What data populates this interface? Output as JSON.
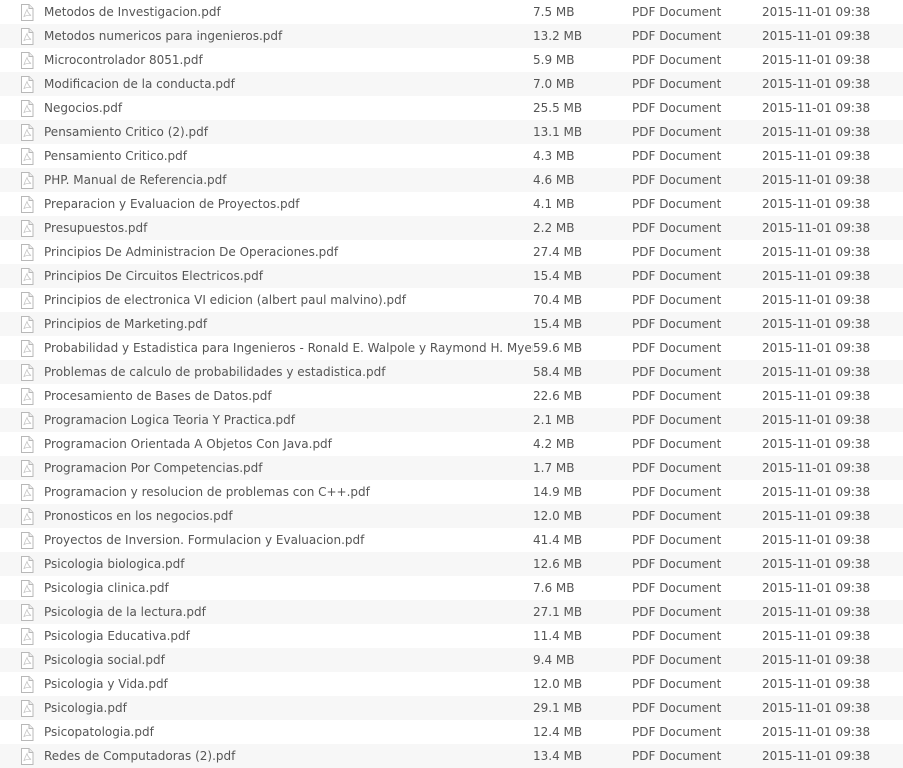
{
  "files": [
    {
      "name": "Metodos de Investigacion.pdf",
      "size": "7.5 MB",
      "type": "PDF Document",
      "date": "2015-11-01 09:38"
    },
    {
      "name": "Metodos numericos para ingenieros.pdf",
      "size": "13.2 MB",
      "type": "PDF Document",
      "date": "2015-11-01 09:38"
    },
    {
      "name": "Microcontrolador 8051.pdf",
      "size": "5.9 MB",
      "type": "PDF Document",
      "date": "2015-11-01 09:38"
    },
    {
      "name": "Modificacion de la conducta.pdf",
      "size": "7.0 MB",
      "type": "PDF Document",
      "date": "2015-11-01 09:38"
    },
    {
      "name": "Negocios.pdf",
      "size": "25.5 MB",
      "type": "PDF Document",
      "date": "2015-11-01 09:38"
    },
    {
      "name": "Pensamiento Critico (2).pdf",
      "size": "13.1 MB",
      "type": "PDF Document",
      "date": "2015-11-01 09:38"
    },
    {
      "name": "Pensamiento Critico.pdf",
      "size": "4.3 MB",
      "type": "PDF Document",
      "date": "2015-11-01 09:38"
    },
    {
      "name": "PHP. Manual de Referencia.pdf",
      "size": "4.6 MB",
      "type": "PDF Document",
      "date": "2015-11-01 09:38"
    },
    {
      "name": "Preparacion y Evaluacion de Proyectos.pdf",
      "size": "4.1 MB",
      "type": "PDF Document",
      "date": "2015-11-01 09:38"
    },
    {
      "name": "Presupuestos.pdf",
      "size": "2.2 MB",
      "type": "PDF Document",
      "date": "2015-11-01 09:38"
    },
    {
      "name": "Principios De Administracion De Operaciones.pdf",
      "size": "27.4 MB",
      "type": "PDF Document",
      "date": "2015-11-01 09:38"
    },
    {
      "name": "Principios De Circuitos Electricos.pdf",
      "size": "15.4 MB",
      "type": "PDF Document",
      "date": "2015-11-01 09:38"
    },
    {
      "name": "Principios de electronica VI edicion (albert paul malvino).pdf",
      "size": "70.4 MB",
      "type": "PDF Document",
      "date": "2015-11-01 09:38"
    },
    {
      "name": "Principios de Marketing.pdf",
      "size": "15.4 MB",
      "type": "PDF Document",
      "date": "2015-11-01 09:38"
    },
    {
      "name": "Probabilidad y Estadistica para Ingenieros - Ronald E. Walpole y Raymond H. Myers.pd",
      "size": "59.6 MB",
      "type": "PDF Document",
      "date": "2015-11-01 09:38"
    },
    {
      "name": "Problemas de calculo de probabilidades y estadistica.pdf",
      "size": "58.4 MB",
      "type": "PDF Document",
      "date": "2015-11-01 09:38"
    },
    {
      "name": "Procesamiento de Bases de Datos.pdf",
      "size": "22.6 MB",
      "type": "PDF Document",
      "date": "2015-11-01 09:38"
    },
    {
      "name": "Programacion Logica Teoria Y Practica.pdf",
      "size": "2.1 MB",
      "type": "PDF Document",
      "date": "2015-11-01 09:38"
    },
    {
      "name": "Programacion Orientada A Objetos Con Java.pdf",
      "size": "4.2 MB",
      "type": "PDF Document",
      "date": "2015-11-01 09:38"
    },
    {
      "name": "Programacion Por Competencias.pdf",
      "size": "1.7 MB",
      "type": "PDF Document",
      "date": "2015-11-01 09:38"
    },
    {
      "name": "Programacion y resolucion de problemas con C++.pdf",
      "size": "14.9 MB",
      "type": "PDF Document",
      "date": "2015-11-01 09:38"
    },
    {
      "name": "Pronosticos en los negocios.pdf",
      "size": "12.0 MB",
      "type": "PDF Document",
      "date": "2015-11-01 09:38"
    },
    {
      "name": "Proyectos de Inversion. Formulacion y Evaluacion.pdf",
      "size": "41.4 MB",
      "type": "PDF Document",
      "date": "2015-11-01 09:38"
    },
    {
      "name": "Psicologia biologica.pdf",
      "size": "12.6 MB",
      "type": "PDF Document",
      "date": "2015-11-01 09:38"
    },
    {
      "name": "Psicologia clinica.pdf",
      "size": "7.6 MB",
      "type": "PDF Document",
      "date": "2015-11-01 09:38"
    },
    {
      "name": "Psicologia de la lectura.pdf",
      "size": "27.1 MB",
      "type": "PDF Document",
      "date": "2015-11-01 09:38"
    },
    {
      "name": "Psicologia Educativa.pdf",
      "size": "11.4 MB",
      "type": "PDF Document",
      "date": "2015-11-01 09:38"
    },
    {
      "name": "Psicologia social.pdf",
      "size": "9.4 MB",
      "type": "PDF Document",
      "date": "2015-11-01 09:38"
    },
    {
      "name": "Psicologia y Vida.pdf",
      "size": "12.0 MB",
      "type": "PDF Document",
      "date": "2015-11-01 09:38"
    },
    {
      "name": "Psicologia.pdf",
      "size": "29.1 MB",
      "type": "PDF Document",
      "date": "2015-11-01 09:38"
    },
    {
      "name": "Psicopatologia.pdf",
      "size": "12.4 MB",
      "type": "PDF Document",
      "date": "2015-11-01 09:38"
    },
    {
      "name": "Redes de Computadoras (2).pdf",
      "size": "13.4 MB",
      "type": "PDF Document",
      "date": "2015-11-01 09:38"
    }
  ],
  "icon": {
    "semantic": "pdf-file-icon",
    "color": "#b8b8b8"
  }
}
